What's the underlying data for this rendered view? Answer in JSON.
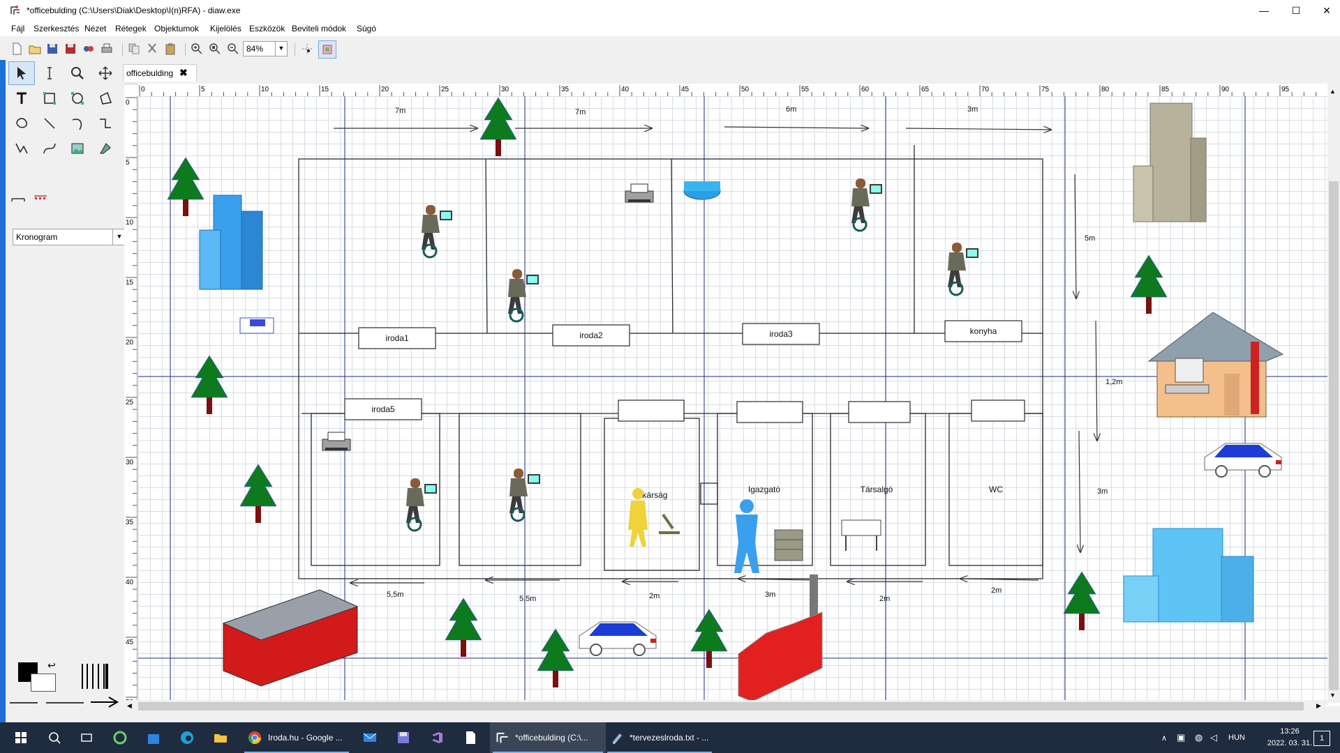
{
  "window": {
    "title": "*officebulding (C:\\Users\\Diak\\Desktop\\I(n)RFA) - diaw.exe",
    "minimize_glyph": "—",
    "maximize_glyph": "☐",
    "close_glyph": "✕"
  },
  "menu": [
    "Fájl",
    "Szerkesztés",
    "Nézet",
    "Rétegek",
    "Objektumok",
    "Kijelölés",
    "Eszközök",
    "Beviteli módok",
    "Súgó"
  ],
  "toolbar": {
    "zoom": "84%",
    "icons": [
      "new-file-icon",
      "open-folder-icon",
      "save-icon",
      "save-as-icon",
      "export-icon",
      "print-icon",
      "copy-icon",
      "cut-icon",
      "paste-icon",
      "zoom-in-icon",
      "zoom-fit-icon",
      "zoom-out-icon"
    ]
  },
  "toolbox": {
    "tools": [
      "pointer-tool",
      "text-edit-tool",
      "magnify-tool",
      "move-tool",
      "text-tool",
      "box-tool",
      "ellipse-tool",
      "polygon-tool",
      "beziergon-tool",
      "line-tool",
      "arc-tool",
      "zigzag-tool",
      "polyline-tool",
      "bezier-tool",
      "image-tool",
      "outline-tool"
    ],
    "sheet": "Kronogram",
    "sheet_dd": "▼"
  },
  "tab": {
    "label": "officebulding",
    "close": "✖"
  },
  "ruler": {
    "h_labels": [
      "0",
      "5",
      "10",
      "15",
      "20",
      "25",
      "30",
      "35",
      "40",
      "45",
      "50",
      "55",
      "60",
      "65",
      "70",
      "75",
      "80",
      "85",
      "90",
      "95"
    ],
    "v_labels": [
      "0",
      "5",
      "10",
      "15",
      "20",
      "25",
      "30",
      "35",
      "40",
      "45",
      "50"
    ]
  },
  "diagram": {
    "rooms": {
      "iroda1": "iroda1",
      "iroda2": "iroda2",
      "iroda3": "iroda3",
      "konyha": "konyha",
      "iroda5": "iroda5",
      "titkarsag": "Titkárság",
      "igazgato": "Igazgató",
      "tarsalgo": "Társalgó",
      "wc": "WC"
    },
    "dimensions": {
      "top1": "7m",
      "top2": "7m",
      "top3": "6m",
      "top4": "3m",
      "right1": "5m",
      "right2": "1,2m",
      "right3": "3m",
      "bottom1": "5,5m",
      "bottom2": "5,5m",
      "bottom3": "2m",
      "bottom4": "3m",
      "bottom5": "2m",
      "bottom6": "2m"
    }
  },
  "taskbar": {
    "chrome": "Iroda.hu - Google ...",
    "dia": "*officebulding (C:\\...",
    "notepad": "*tervezeslroda.txt - ...",
    "lang": "HUN",
    "time": "13:26",
    "date": "2022. 03. 31.",
    "notif": "1"
  },
  "colors": {
    "tree_green": "#0d7a1e",
    "trunk": "#7a1010",
    "blue_building": "#3aa0ee",
    "guide_line": "#1d2a8c",
    "selection": "#3b4bd6"
  }
}
